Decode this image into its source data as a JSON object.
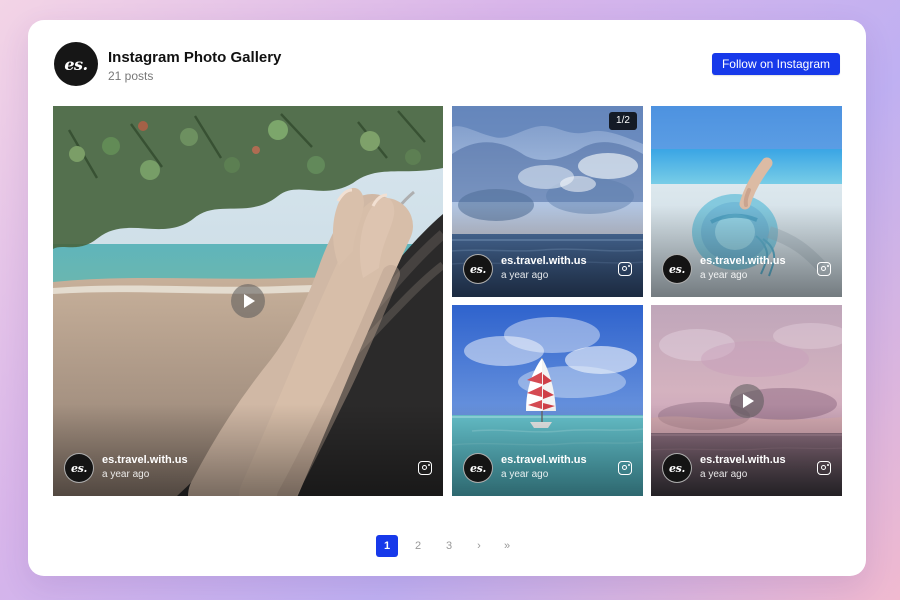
{
  "header": {
    "logo_text": "es.",
    "title": "Instagram Photo Gallery",
    "subtitle": "21 posts",
    "follow_label": "Follow on Instagram"
  },
  "icons": {
    "profile_avatar": "es-logo-icon",
    "instagram": "instagram-icon",
    "play": "play-icon"
  },
  "gallery": {
    "posts": [
      {
        "id": "post-1",
        "username": "es.travel.with.us",
        "time": "a year ago",
        "has_play": true
      },
      {
        "id": "post-2",
        "username": "es.travel.with.us",
        "time": "a year ago",
        "badge": "1/2"
      },
      {
        "id": "post-3",
        "username": "es.travel.with.us",
        "time": "a year ago"
      },
      {
        "id": "post-4",
        "username": "es.travel.with.us",
        "time": "a year ago"
      },
      {
        "id": "post-5",
        "username": "es.travel.with.us",
        "time": "a year ago",
        "has_play": true
      }
    ]
  },
  "pagination": {
    "pages": [
      "1",
      "2",
      "3"
    ],
    "next": "›",
    "last": "»",
    "current": "1"
  },
  "colors": {
    "accent": "#1739ea",
    "text": "#111111",
    "muted": "#777777",
    "background_gradient": [
      "#f3d4e6",
      "#d8b5ea",
      "#bfb0f2",
      "#f0b9cf"
    ]
  }
}
